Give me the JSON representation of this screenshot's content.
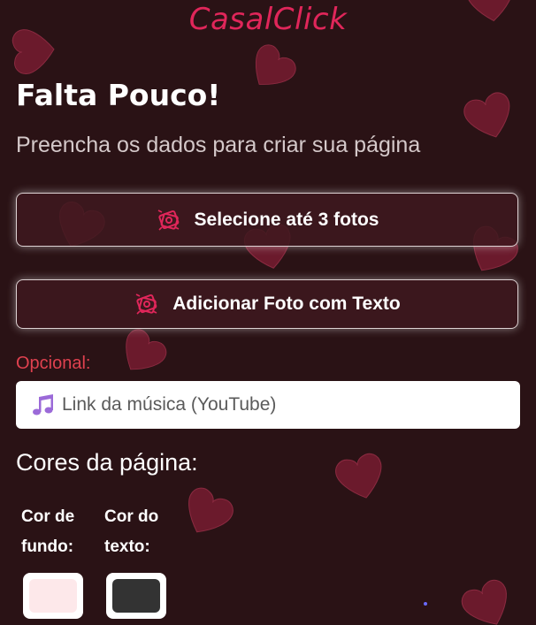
{
  "brand": {
    "logo_text": "CasalClick"
  },
  "header": {
    "title": "Falta Pouco!",
    "subtitle": "Preencha os dados para criar sua página"
  },
  "buttons": {
    "select_photos": {
      "label": "Selecione até 3 fotos",
      "icon": "photo-icon"
    },
    "add_photo_text": {
      "label": "Adicionar Foto com Texto",
      "icon": "photo-icon"
    }
  },
  "music": {
    "optional_label": "Opcional:",
    "placeholder": "Link da música (YouTube)",
    "icon": "music-note-icon"
  },
  "colors": {
    "section_title": "Cores da página:",
    "background": {
      "label": "Cor de fundo:",
      "value": "#fde8ea"
    },
    "text": {
      "label": "Cor do texto:",
      "value": "#333333"
    }
  },
  "theme": {
    "page_background": "#2a1215",
    "accent": "#e0265a",
    "heart": "#6b1a2c",
    "optional_color": "#e0414f"
  }
}
